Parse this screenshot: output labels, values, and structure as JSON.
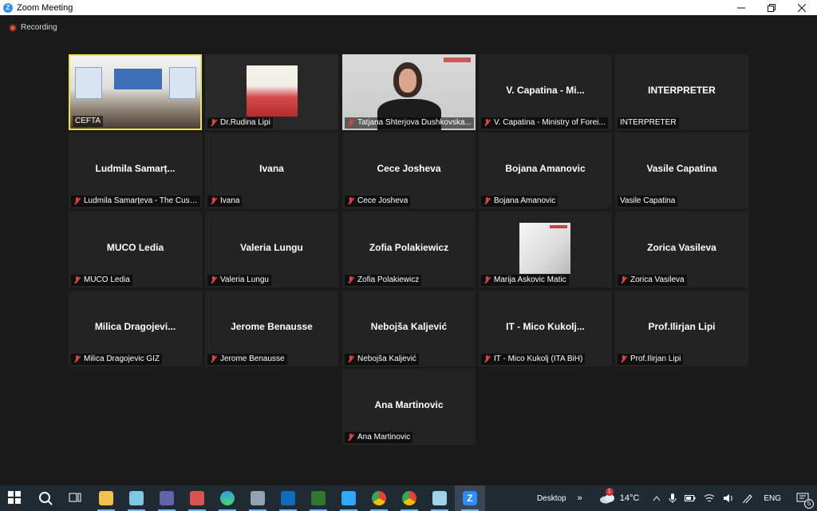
{
  "window": {
    "title": "Zoom Meeting",
    "controls": [
      "minimize",
      "maximize",
      "close"
    ]
  },
  "recording": {
    "label": "Recording"
  },
  "tiles": [
    {
      "name": "",
      "label": "CEFTA",
      "video": "cefta",
      "muted": false
    },
    {
      "name": "",
      "label": "Dr.Rudina Lipi",
      "video": "rudina",
      "muted": true
    },
    {
      "name": "",
      "label": "Tatjana Shterjova Dushkovska...",
      "video": "tatjana",
      "muted": true
    },
    {
      "name": "V. Capatina - Mi...",
      "label": "V. Capatina - Ministry of Forei...",
      "video": "",
      "muted": true
    },
    {
      "name": "INTERPRETER",
      "label": "INTERPRETER",
      "video": "",
      "muted": false
    },
    {
      "name": "Ludmila Samarț...",
      "label": "Ludmila Samarțeva - The Cust...",
      "video": "",
      "muted": true
    },
    {
      "name": "Ivana",
      "label": "Ivana",
      "video": "",
      "muted": true
    },
    {
      "name": "Cece Josheva",
      "label": "Cece Josheva",
      "video": "",
      "muted": true
    },
    {
      "name": "Bojana Amanovic",
      "label": "Bojana Amanovic",
      "video": "",
      "muted": true
    },
    {
      "name": "Vasile Capatina",
      "label": "Vasile Capatina",
      "video": "",
      "muted": false
    },
    {
      "name": "MUCO Ledia",
      "label": "MUCO Ledia",
      "video": "",
      "muted": true
    },
    {
      "name": "Valeria Lungu",
      "label": "Valeria Lungu",
      "video": "",
      "muted": true
    },
    {
      "name": "Zofia Polakiewicz",
      "label": "Zofia Polakiewicz",
      "video": "",
      "muted": true
    },
    {
      "name": "",
      "label": "Marija Askovic Matic",
      "video": "marija",
      "muted": true
    },
    {
      "name": "Zorica Vasileva",
      "label": "Zorica Vasileva",
      "video": "",
      "muted": true
    },
    {
      "name": "Milica Dragojevi...",
      "label": "Milica Dragojevic GIZ",
      "video": "",
      "muted": true
    },
    {
      "name": "Jerome Benausse",
      "label": "Jerome Benausse",
      "video": "",
      "muted": true
    },
    {
      "name": "Nebojša Kaljević",
      "label": "Nebojša Kaljević",
      "video": "",
      "muted": true
    },
    {
      "name": "IT - Mico Kukolj...",
      "label": "IT - Mico Kukolj (ITA BiH)",
      "video": "",
      "muted": true
    },
    {
      "name": "Prof.Ilirjan Lipi",
      "label": "Prof.Ilirjan Lipi",
      "video": "",
      "muted": true
    },
    {
      "name": "Ana Martinovic",
      "label": "Ana Martinovic",
      "video": "",
      "muted": true
    }
  ],
  "taskbar": {
    "apps": [
      {
        "icon": "windows-start-icon",
        "color": "#ffffff"
      },
      {
        "icon": "search-icon",
        "color": "#ffffff"
      },
      {
        "icon": "task-view-icon",
        "color": "#ffffff"
      },
      {
        "icon": "file-explorer-icon",
        "color": "#f2c14e"
      },
      {
        "icon": "paint-icon",
        "color": "#7ec8e3"
      },
      {
        "icon": "teams-icon",
        "color": "#6264a7"
      },
      {
        "icon": "app-red-icon",
        "color": "#d9534f"
      },
      {
        "icon": "edge-icon",
        "color": "#2fa5d6"
      },
      {
        "icon": "calculator-icon",
        "color": "#8fa3b3"
      },
      {
        "icon": "outlook-icon",
        "color": "#0f6cbd"
      },
      {
        "icon": "project-icon",
        "color": "#31752f"
      },
      {
        "icon": "photoshop-icon",
        "color": "#31a8ff"
      },
      {
        "icon": "chrome-icon",
        "color": "#e94235"
      },
      {
        "icon": "chrome-profile-icon",
        "color": "#e94235"
      },
      {
        "icon": "notepad-icon",
        "color": "#9fd3e8"
      },
      {
        "icon": "zoom-icon",
        "color": "#2d8cff"
      }
    ],
    "desktop_label": "Desktop",
    "chevron": "»",
    "weather_badge": "1",
    "temperature": "14°C",
    "language": "ENG",
    "notification_count": "5"
  }
}
